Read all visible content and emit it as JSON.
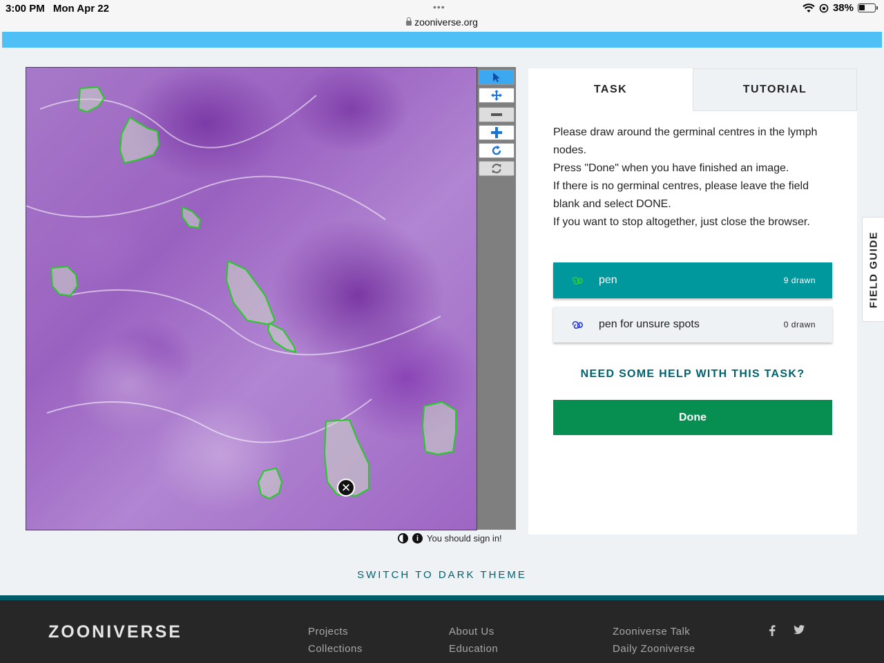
{
  "status_bar": {
    "time": "3:00 PM",
    "date": "Mon Apr 22",
    "dots": "•••",
    "url": "zooniverse.org",
    "battery": "38%",
    "battery_level": 0.38
  },
  "toolbar": {
    "icons": [
      "cursor-icon",
      "move-icon",
      "zoom-out-icon",
      "zoom-in-icon",
      "rotate-icon",
      "reset-icon"
    ]
  },
  "tabs": {
    "task": "TASK",
    "tutorial": "TUTORIAL"
  },
  "instructions": [
    "Please draw around the germinal centres in the lymph nodes.",
    "Press \"Done\" when you have finished an image.",
    "If there is no germinal centres, please leave the field blank and select DONE.",
    "If you want to stop altogether, just close the browser."
  ],
  "tools": [
    {
      "label": "pen",
      "count": "9 drawn",
      "color": "#2ecc40"
    },
    {
      "label": "pen for unsure spots",
      "count": "0 drawn",
      "color": "#2b3bd6"
    }
  ],
  "help_link": "NEED SOME HELP WITH THIS TASK?",
  "done_label": "Done",
  "sign_in": "You should sign in!",
  "field_guide": "FIELD GUIDE",
  "dark_theme": "SWITCH TO DARK THEME",
  "footer": {
    "logo": "ZOONIVERSE",
    "col1": [
      "Projects",
      "Collections"
    ],
    "col2": [
      "About Us",
      "Education"
    ],
    "col3": [
      "Zooniverse Talk",
      "Daily Zooniverse"
    ],
    "social": [
      "facebook-icon",
      "twitter-icon"
    ]
  },
  "colors": {
    "accent": "#00979d",
    "done": "#078f52",
    "header": "#4ec0f5",
    "drawn_outline": "#2ecc40"
  }
}
